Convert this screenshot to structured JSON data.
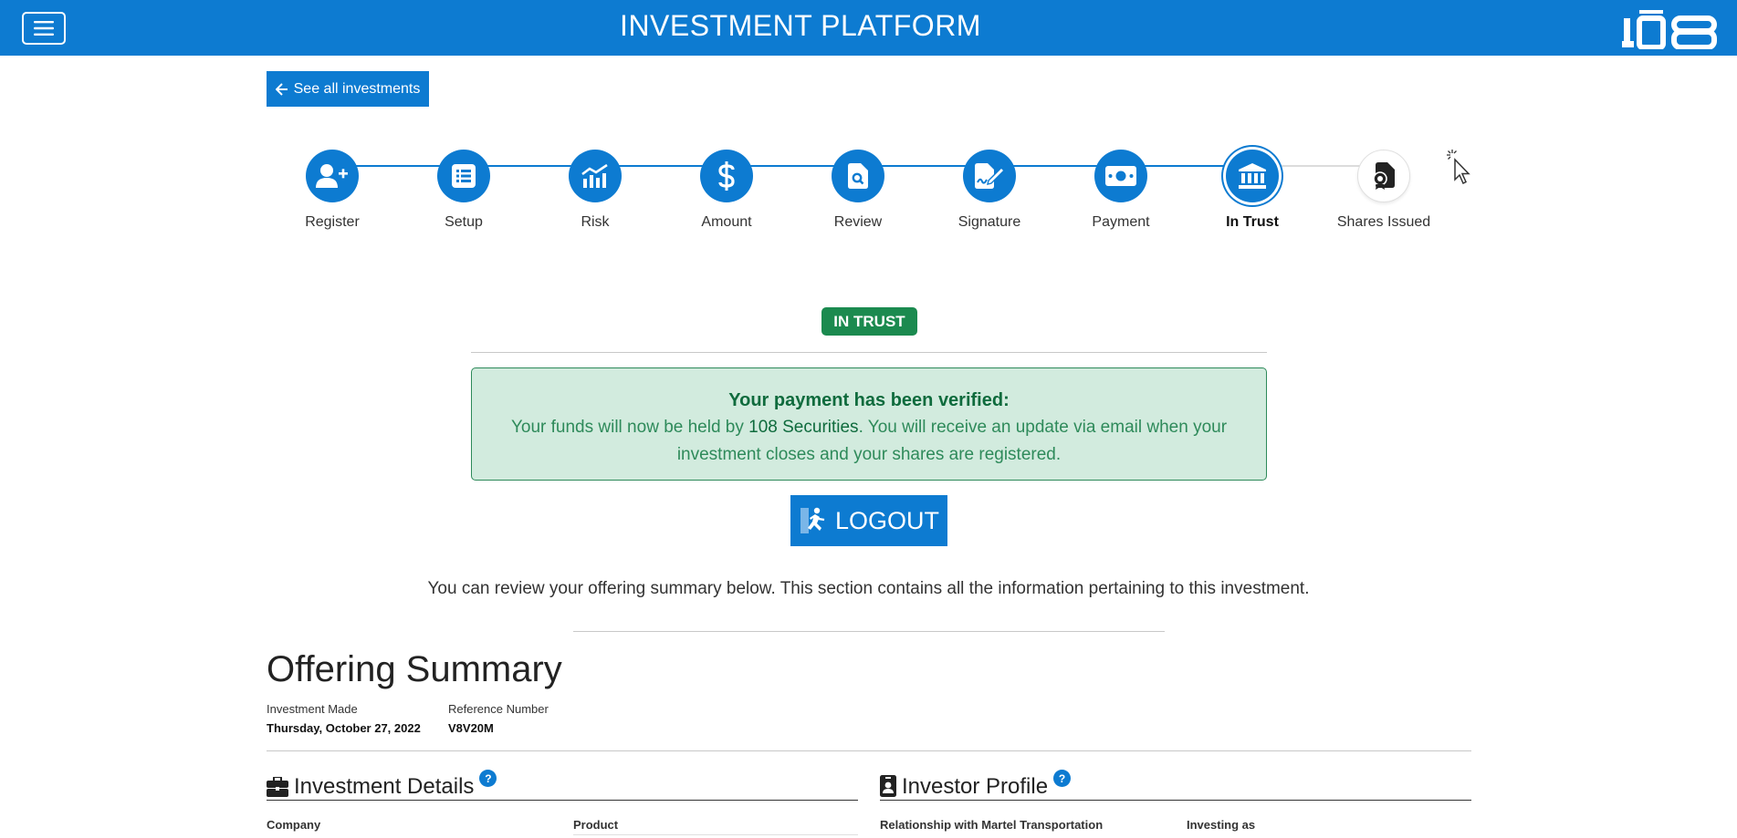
{
  "header": {
    "title": "INVESTMENT PLATFORM",
    "brand": "108",
    "menu_icon": "hamburger-menu-icon",
    "bg_color": "#0d7bd1"
  },
  "back_button": {
    "label": "See all investments",
    "icon": "arrow-left-icon"
  },
  "stepper": {
    "steps": [
      {
        "label": "Register",
        "icon": "user-plus-icon",
        "state": "complete"
      },
      {
        "label": "Setup",
        "icon": "list-icon",
        "state": "complete"
      },
      {
        "label": "Risk",
        "icon": "chart-line-icon",
        "state": "complete"
      },
      {
        "label": "Amount",
        "icon": "dollar-icon",
        "state": "complete"
      },
      {
        "label": "Review",
        "icon": "file-search-icon",
        "state": "complete"
      },
      {
        "label": "Signature",
        "icon": "file-signature-icon",
        "state": "complete"
      },
      {
        "label": "Payment",
        "icon": "money-bill-icon",
        "state": "complete"
      },
      {
        "label": "In Trust",
        "icon": "bank-icon",
        "state": "current"
      },
      {
        "label": "Shares Issued",
        "icon": "file-certificate-icon",
        "state": "pending"
      }
    ]
  },
  "status": {
    "badge": "IN TRUST",
    "color": "#1b8a4f"
  },
  "alert": {
    "title": "Your payment has been verified:",
    "body_prefix": "Your funds will now be held by ",
    "body_strong": "108 Securities",
    "body_suffix": ". You will receive an update via email when your investment closes and your shares are registered."
  },
  "logout": {
    "label": "LOGOUT",
    "icon": "running-exit-icon"
  },
  "review_text": "You can review your offering summary below. This section contains all the information pertaining to this investment.",
  "summary": {
    "title": "Offering Summary",
    "investment_made_label": "Investment Made",
    "investment_made_value": "Thursday, October 27, 2022",
    "reference_label": "Reference Number",
    "reference_value": "V8V20M"
  },
  "investment_details": {
    "title": "Investment Details",
    "icon": "briefcase-icon",
    "col1": "Company",
    "col2": "Product"
  },
  "investor_profile": {
    "title": "Investor Profile",
    "icon": "id-badge-icon",
    "col1": "Relationship with Martel Transportation",
    "col2": "Investing as"
  },
  "help_glyph": "?"
}
